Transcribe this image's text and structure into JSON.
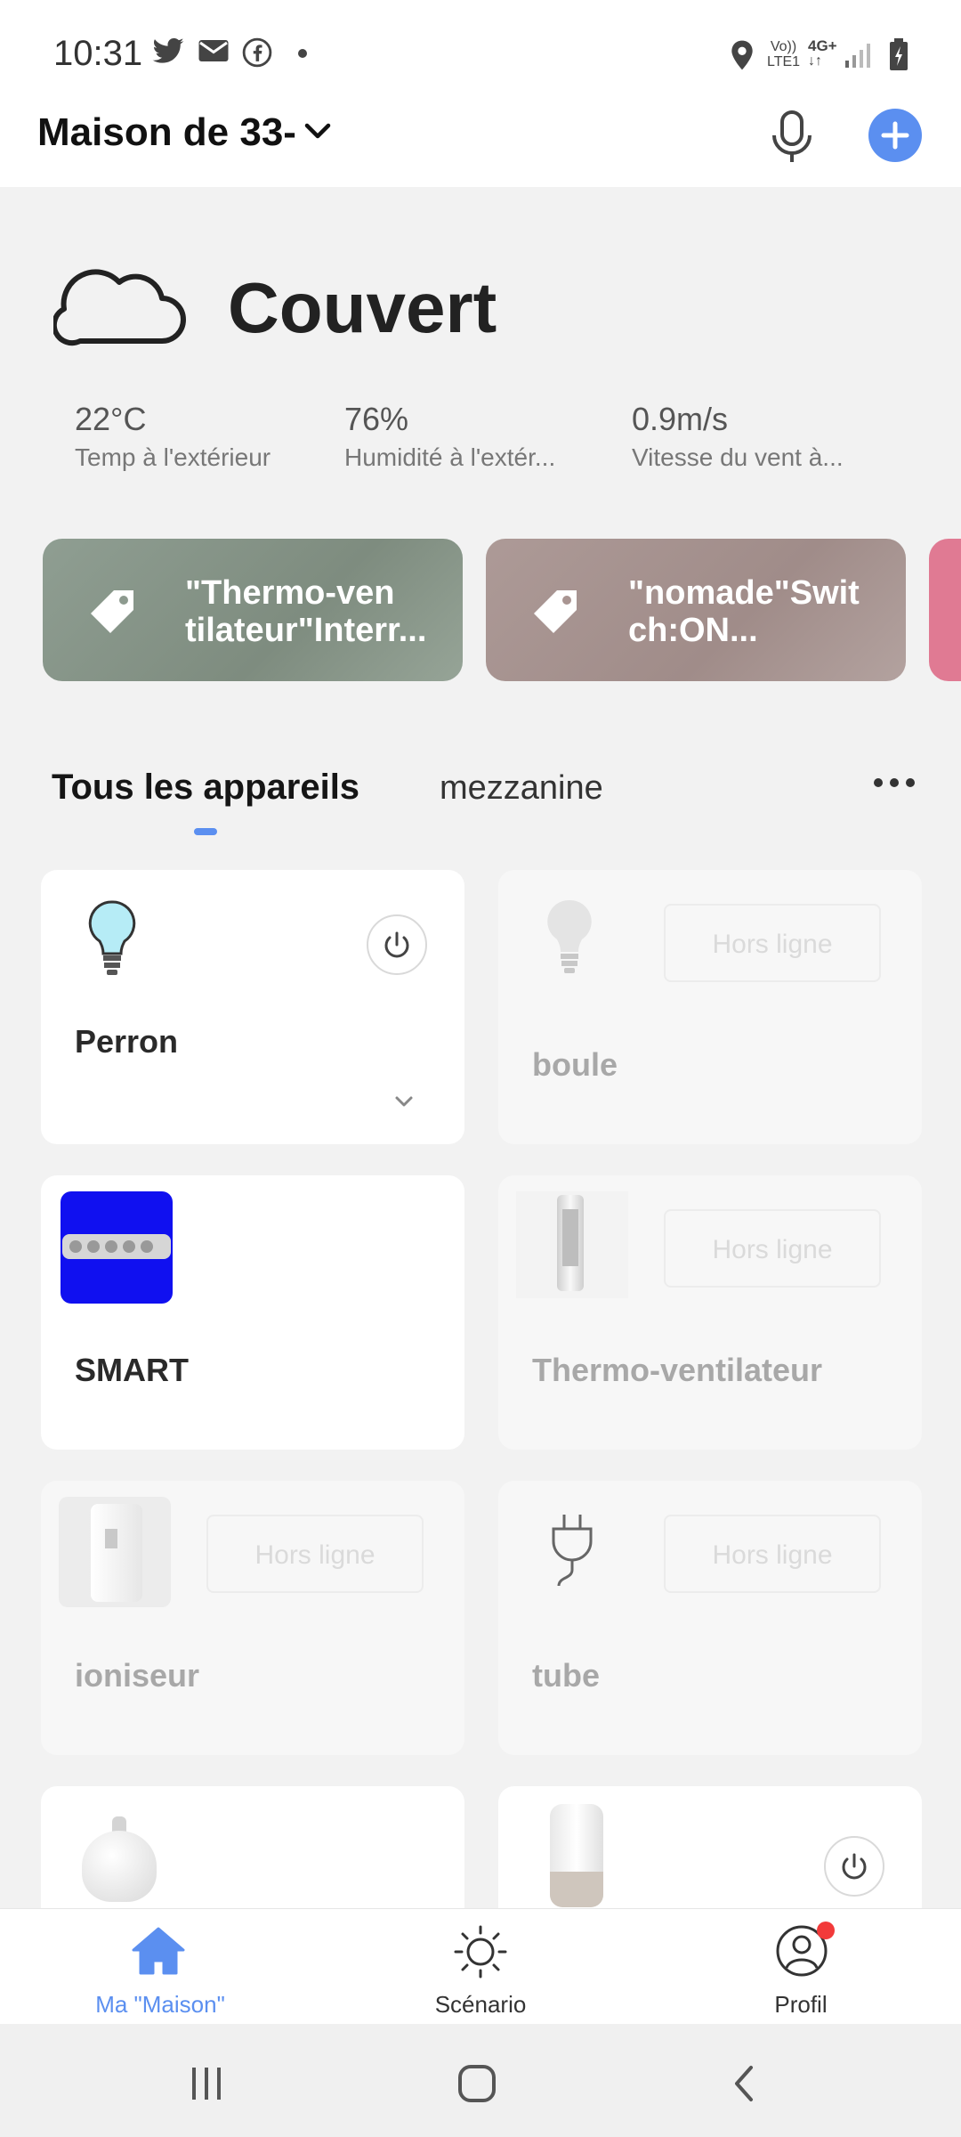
{
  "status_bar": {
    "time": "10:31",
    "notif_icons": [
      "twitter-icon",
      "mail-icon",
      "facebook-icon",
      "dot-icon"
    ],
    "right_icons": [
      "location-icon",
      "volte-icon",
      "4g-icon",
      "signal-icon",
      "battery-icon"
    ],
    "volte_line1": "Vo))",
    "volte_line2": "LTE1",
    "net_label": "4G+"
  },
  "header": {
    "home_name": "Maison de 33-",
    "accent": "#5b8ff0"
  },
  "weather": {
    "condition": "Couvert",
    "temp": "22°C",
    "temp_label": "Temp à l'extérieur",
    "humidity": "76%",
    "humidity_label": "Humidité à l'extér...",
    "wind": "0.9m/s",
    "wind_label": "Vitesse du vent à..."
  },
  "scenes": [
    {
      "line1": "\"Thermo-ven",
      "line2": "tilateur\"Interr...",
      "color": "#8d9a8f"
    },
    {
      "line1": "\"nomade\"Swit",
      "line2": "ch:ON...",
      "color": "#a99592"
    },
    {
      "color": "#e07a93"
    }
  ],
  "tabs": {
    "all": "Tous les appareils",
    "mezzanine": "mezzanine"
  },
  "devices": [
    {
      "name": "Perron",
      "state": "online",
      "icon": "bulb-icon"
    },
    {
      "name": "boule",
      "state": "offline",
      "icon": "bulb-icon"
    },
    {
      "name": "SMART",
      "state": "online",
      "icon": "power-strip-icon"
    },
    {
      "name": "Thermo-ventilateur",
      "state": "offline",
      "icon": "tower-heater-icon"
    },
    {
      "name": "ioniseur",
      "state": "offline",
      "icon": "air-purifier-icon"
    },
    {
      "name": "tube",
      "state": "offline",
      "icon": "plug-icon"
    },
    {
      "name": "",
      "state": "online",
      "icon": "diffuser-icon"
    },
    {
      "name": "",
      "state": "online",
      "icon": "humidifier-icon"
    }
  ],
  "offline_label": "Hors ligne",
  "bottom_nav": {
    "home": "Ma \"Maison\"",
    "scenario": "Scénario",
    "profile": "Profil",
    "active_color": "#5b8ff0",
    "badge_color": "#f23a3a"
  }
}
